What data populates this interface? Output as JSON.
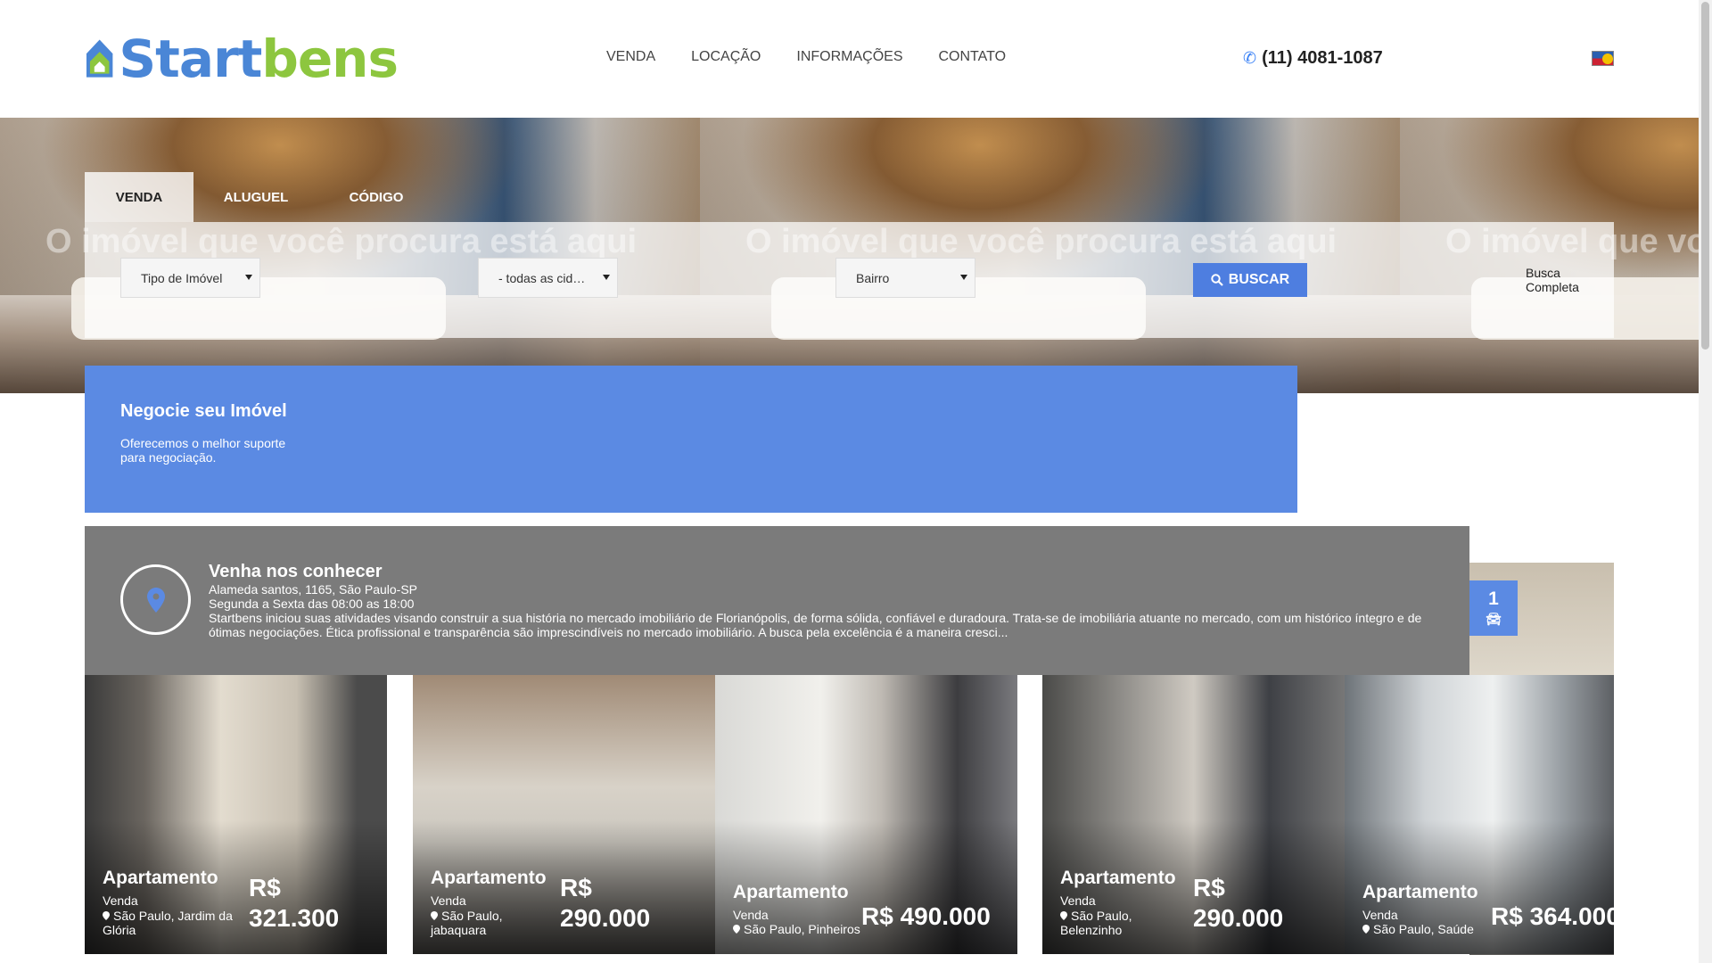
{
  "brand": {
    "name_part1": "Start",
    "name_part2": "bens",
    "colors": {
      "blue": "#4a86d6",
      "green": "#8dc63f",
      "accent": "#5b8ae3"
    }
  },
  "nav": {
    "items": [
      {
        "label": "VENDA"
      },
      {
        "label": "LOCAÇÃO"
      },
      {
        "label": "INFORMAÇÕES"
      },
      {
        "label": "CONTATO"
      }
    ]
  },
  "phone": {
    "icon": "phone-icon",
    "number": "(11) 4081-1087"
  },
  "hero": {
    "tagline": "O imóvel que você procura está aqui",
    "tabs": [
      {
        "label": "VENDA"
      },
      {
        "label": "ALUGUEL"
      },
      {
        "label": "CÓDIGO"
      }
    ],
    "selects": {
      "tipo": "Tipo de Imóvel",
      "cidade": "- todas as cidades -",
      "bairro": "Bairro"
    },
    "buscar_label": "BUSCAR",
    "busca_completa": "Busca Completa"
  },
  "negocie": {
    "title": "Negocie seu Imóvel",
    "text": "Oferecemos o melhor suporte para negociação."
  },
  "about": {
    "title": "Venha nos conhecer",
    "address": "Alameda santos, 1165, São Paulo-SP",
    "hours": "Segunda a Sexta das 08:00 as 18:00",
    "description": "Startbens iniciou suas atividades visando construir a sua história no mercado imobiliário de Florianópolis, de forma sólida, confiável e duradoura. Trata-se de imobiliária atuante no mercado, com um histórico íntegro e de ótimas negociações. Ética profissional e transparência são imprescindíveis no mercado imobiliário. A busca pela excelência é a maneira cresci..."
  },
  "badge": {
    "count": "1",
    "icon": "car-icon"
  },
  "listings": [
    {
      "type": "Apartamento",
      "mode": "Venda",
      "location": "São Paulo, Jardim da Glória",
      "price": "R$ 321.300"
    },
    {
      "type": "Apartamento",
      "mode": "Venda",
      "location": "São Paulo, jabaquara",
      "price": "R$ 290.000"
    },
    {
      "type": "Apartamento",
      "mode": "Venda",
      "location": "São Paulo, Pinheiros",
      "price": "R$ 490.000"
    },
    {
      "type": "Apartamento",
      "mode": "Venda",
      "location": "São Paulo, Belenzinho",
      "price": "R$ 290.000"
    },
    {
      "type": "Apartamento",
      "mode": "Venda",
      "location": "São Paulo, Saúde",
      "price": "R$ 364.000"
    }
  ]
}
